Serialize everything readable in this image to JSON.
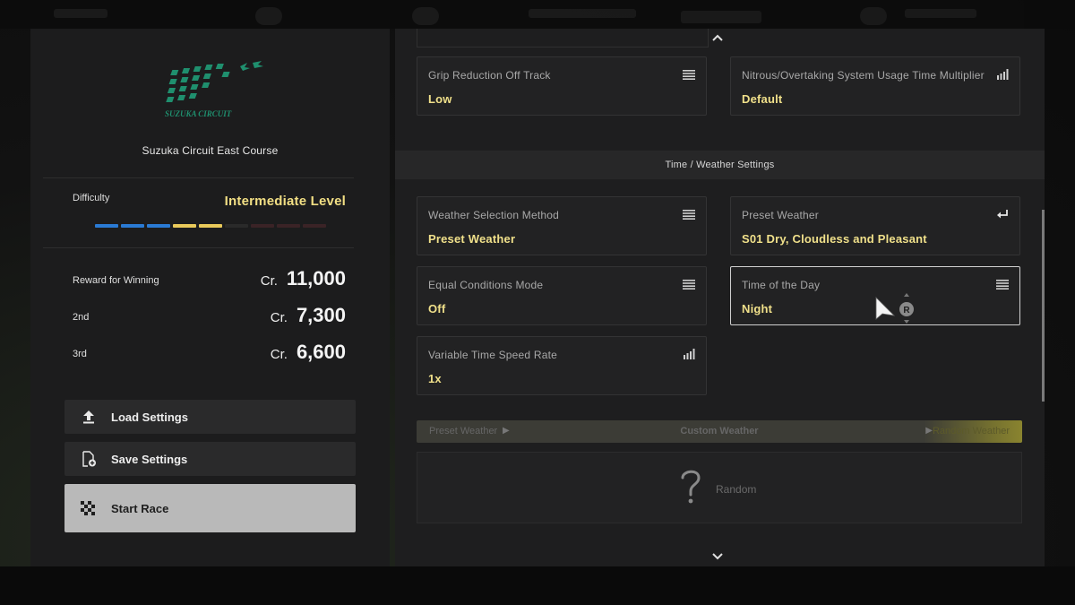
{
  "background": {
    "top_bar_color": "#0c0c0c",
    "bottom_bar_color": "#0a0a0a"
  },
  "left_panel": {
    "logo": {
      "text": "SUZUKA CIRCUIT",
      "color": "#1f8f6e"
    },
    "track_name": "Suzuka Circuit East Course",
    "difficulty": {
      "label": "Difficulty",
      "value": "Intermediate Level",
      "segments": [
        "#2a7ad4",
        "#2a7ad4",
        "#2a7ad4",
        "#e9c95a",
        "#e9c95a",
        "#2a2a2a",
        "#3a2326",
        "#3a2326",
        "#3a2326"
      ]
    },
    "rewards": [
      {
        "label": "Reward for Winning",
        "currency": "Cr.",
        "amount": "11,000"
      },
      {
        "label": "2nd",
        "currency": "Cr.",
        "amount": "7,300"
      },
      {
        "label": "3rd",
        "currency": "Cr.",
        "amount": "6,600"
      }
    ],
    "buttons": {
      "load": {
        "label": "Load Settings",
        "icon": "upload-icon"
      },
      "save": {
        "label": "Save Settings",
        "icon": "save-file-icon"
      },
      "start": {
        "label": "Start Race",
        "icon": "checkered-flag-icon"
      }
    }
  },
  "right_panel": {
    "cards_top": [
      {
        "title": "Grip Reduction Off Track",
        "value": "Low",
        "icon": "list-icon"
      },
      {
        "title": "Nitrous/Overtaking System Usage Time Multiplier",
        "value": "Default",
        "icon": "signal-bars-icon"
      }
    ],
    "section_title": "Time / Weather Settings",
    "cards": [
      {
        "title": "Weather Selection Method",
        "value": "Preset Weather",
        "icon": "list-icon"
      },
      {
        "title": "Preset Weather",
        "value": "S01 Dry, Cloudless and Pleasant",
        "icon": "enter-icon"
      },
      {
        "title": "Equal Conditions Mode",
        "value": "Off",
        "icon": "list-icon"
      },
      {
        "title": "Time of the Day",
        "value": "Night",
        "icon": "list-icon"
      },
      {
        "title": "Variable Time Speed Rate",
        "value": "1x",
        "icon": "signal-bars-icon"
      }
    ],
    "weather_tabs": {
      "previous": "Preset Weather",
      "current": "Custom Weather",
      "next": "Random Weather"
    },
    "random_option": {
      "label": "Random",
      "icon": "question-mark-icon"
    },
    "value_color": "#f0e08a"
  },
  "controller_hint": {
    "button": "R"
  }
}
